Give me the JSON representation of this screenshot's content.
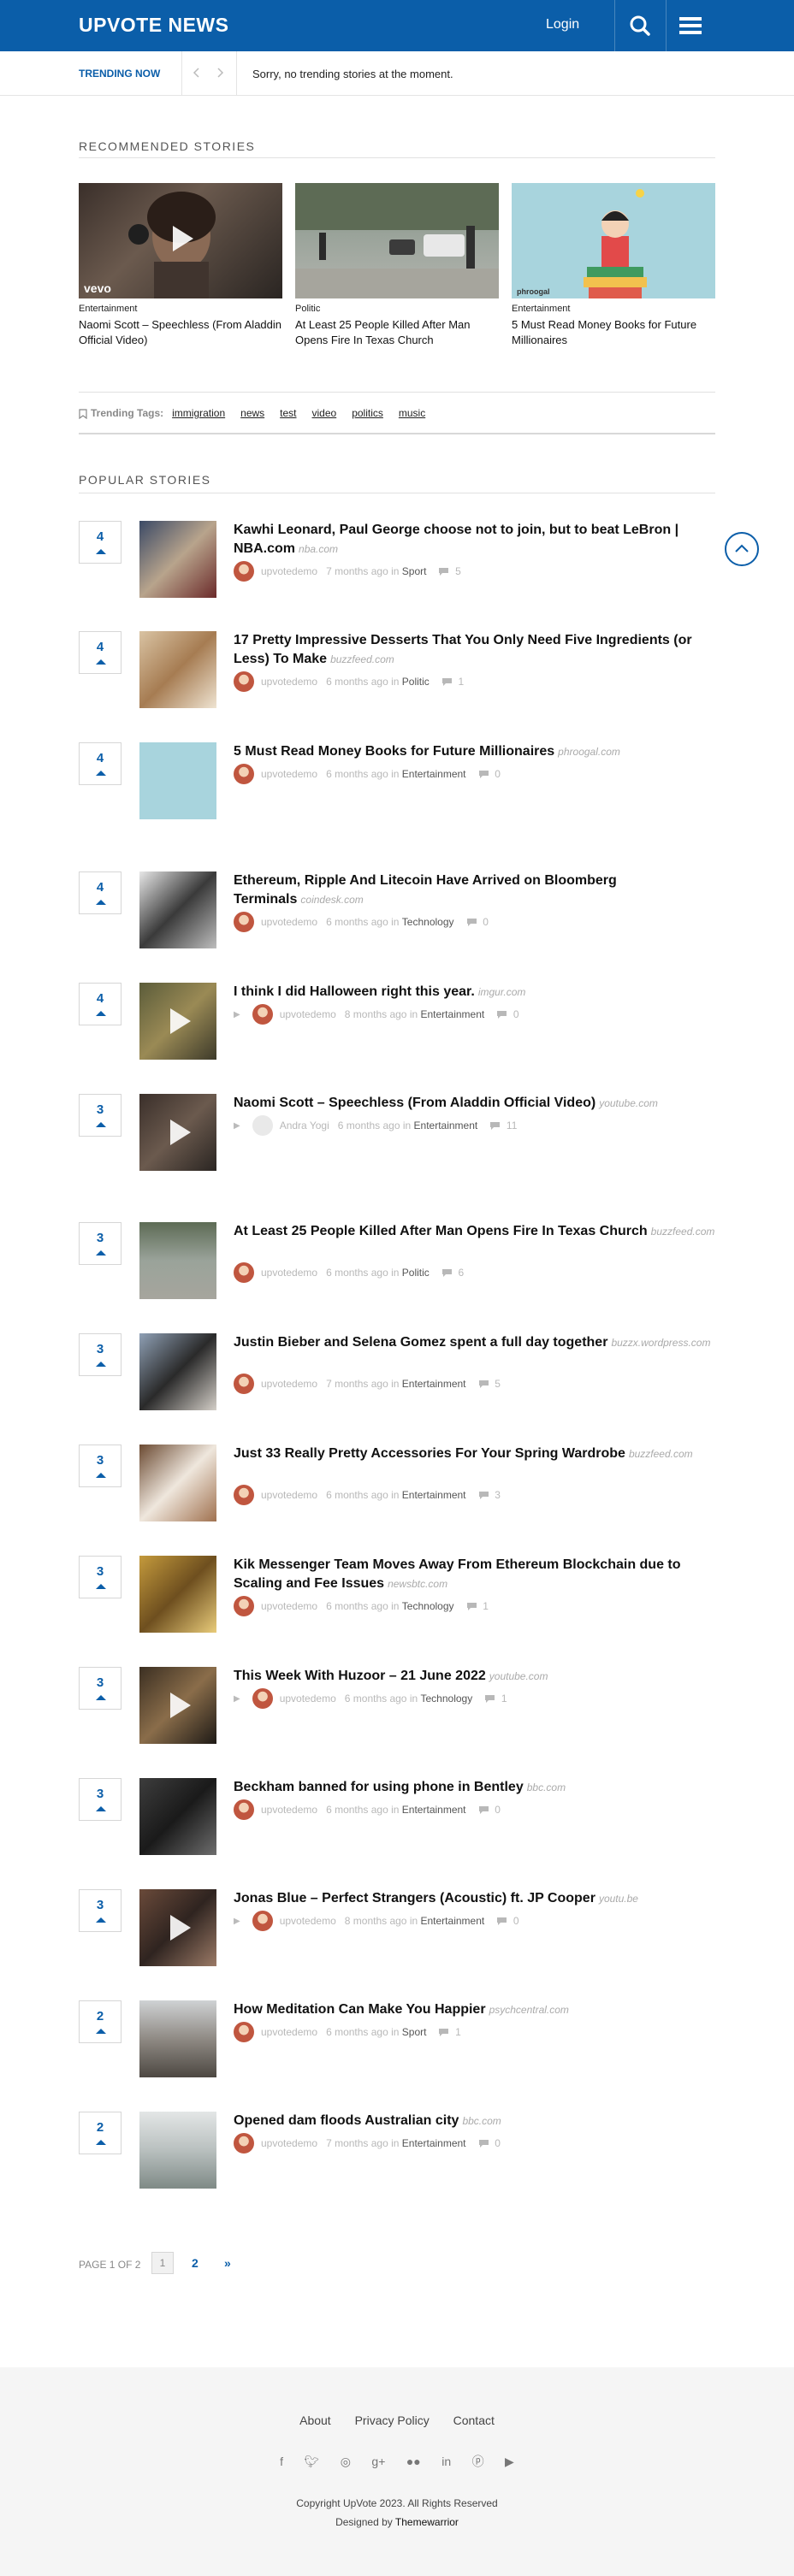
{
  "header": {
    "logo": "UPVOTE NEWS",
    "login_label": "Login",
    "search_icon": "search-icon",
    "menu_icon": "hamburger-menu-icon",
    "brand_color": "#0b5ea9"
  },
  "trending": {
    "label": "TRENDING NOW",
    "message": "Sorry, no trending stories at the moment."
  },
  "recommended": {
    "title": "RECOMMENDED STORIES",
    "cards": [
      {
        "category": "Entertainment",
        "title": "Naomi Scott – Speechless (From Aladdin Official Video)",
        "watermark": "vevo"
      },
      {
        "category": "Politic",
        "title": "At Least 25 People Killed After Man Opens Fire In Texas Church"
      },
      {
        "category": "Entertainment",
        "title": "5 Must Read Money Books for Future Millionaires",
        "watermark": "phroogal"
      }
    ],
    "tags_label": "Trending Tags:",
    "tags": [
      "immigration",
      "news",
      "test",
      "video",
      "politics",
      "music"
    ]
  },
  "popular": {
    "title": "POPULAR STORIES",
    "items": [
      {
        "votes": "4",
        "title": "Kawhi Leonard, Paul George choose not to join, but to beat LeBron | NBA.com",
        "source": "nba.com",
        "author": "upvotedemo",
        "time": "7 months ago in",
        "category": "Sport",
        "comments": "5"
      },
      {
        "votes": "4",
        "title": "17 Pretty Impressive Desserts That You Only Need Five Ingredients (or Less) To Make",
        "source": "buzzfeed.com",
        "author": "upvotedemo",
        "time": "6 months ago in",
        "category": "Politic",
        "comments": "1"
      },
      {
        "votes": "4",
        "title": "5 Must Read Money Books for Future Millionaires",
        "source": "phroogal.com",
        "author": "upvotedemo",
        "time": "6 months ago in",
        "category": "Entertainment",
        "comments": "0"
      },
      {
        "votes": "4",
        "title": "Ethereum, Ripple And Litecoin Have Arrived on Bloomberg Terminals",
        "source": "coindesk.com",
        "author": "upvotedemo",
        "time": "6 months ago in",
        "category": "Technology",
        "comments": "0"
      },
      {
        "votes": "4",
        "title": "I think I did Halloween right this year.",
        "source": "imgur.com",
        "author": "upvotedemo",
        "time": "8 months ago in",
        "category": "Entertainment",
        "comments": "0",
        "video": true
      },
      {
        "votes": "3",
        "title": "Naomi Scott – Speechless (From Aladdin Official Video)",
        "source": "youtube.com",
        "author": "Andra Yogi",
        "time": "6 months ago in",
        "category": "Entertainment",
        "comments": "11",
        "video": true
      },
      {
        "votes": "3",
        "title": "At Least 25 People Killed After Man Opens Fire In Texas Church",
        "source": "buzzfeed.com",
        "author": "upvotedemo",
        "time": "6 months ago in",
        "category": "Politic",
        "comments": "6"
      },
      {
        "votes": "3",
        "title": "Justin Bieber and Selena Gomez spent a full day together",
        "source": "buzzx.wordpress.com",
        "author": "upvotedemo",
        "time": "7 months ago in",
        "category": "Entertainment",
        "comments": "5"
      },
      {
        "votes": "3",
        "title": "Just 33 Really Pretty Accessories For Your Spring Wardrobe",
        "source": "buzzfeed.com",
        "author": "upvotedemo",
        "time": "6 months ago in",
        "category": "Entertainment",
        "comments": "3"
      },
      {
        "votes": "3",
        "title": "Kik Messenger Team Moves Away From Ethereum Blockchain due to Scaling and Fee Issues",
        "source": "newsbtc.com",
        "author": "upvotedemo",
        "time": "6 months ago in",
        "category": "Technology",
        "comments": "1"
      },
      {
        "votes": "3",
        "title": "This Week With Huzoor – 21 June 2022",
        "source": "youtube.com",
        "author": "upvotedemo",
        "time": "6 months ago in",
        "category": "Technology",
        "comments": "1",
        "video": true
      },
      {
        "votes": "3",
        "title": "Beckham banned for using phone in Bentley",
        "source": "bbc.com",
        "author": "upvotedemo",
        "time": "6 months ago in",
        "category": "Entertainment",
        "comments": "0"
      },
      {
        "votes": "3",
        "title": "Jonas Blue – Perfect Strangers (Acoustic) ft. JP Cooper",
        "source": "youtu.be",
        "author": "upvotedemo",
        "time": "8 months ago in",
        "category": "Entertainment",
        "comments": "0",
        "video": true
      },
      {
        "votes": "2",
        "title": "How Meditation Can Make You Happier",
        "source": "psychcentral.com",
        "author": "upvotedemo",
        "time": "6 months ago in",
        "category": "Sport",
        "comments": "1"
      },
      {
        "votes": "2",
        "title": "Opened dam floods Australian city",
        "source": "bbc.com",
        "author": "upvotedemo",
        "time": "7 months ago in",
        "category": "Entertainment",
        "comments": "0"
      }
    ]
  },
  "pagination": {
    "label": "PAGE 1 OF 2",
    "current": "1",
    "next_page": "2",
    "next_arrow": "»"
  },
  "footer": {
    "links": [
      "About",
      "Privacy Policy",
      "Contact"
    ],
    "social_icons": [
      "facebook-icon",
      "twitter-icon",
      "instagram-icon",
      "google-plus-icon",
      "flickr-icon",
      "linkedin-icon",
      "pinterest-icon",
      "youtube-icon"
    ],
    "copyright": "Copyright UpVote 2023. All Rights Reserved",
    "designed_prefix": "Designed by",
    "designed_by": "Themewarrior"
  }
}
